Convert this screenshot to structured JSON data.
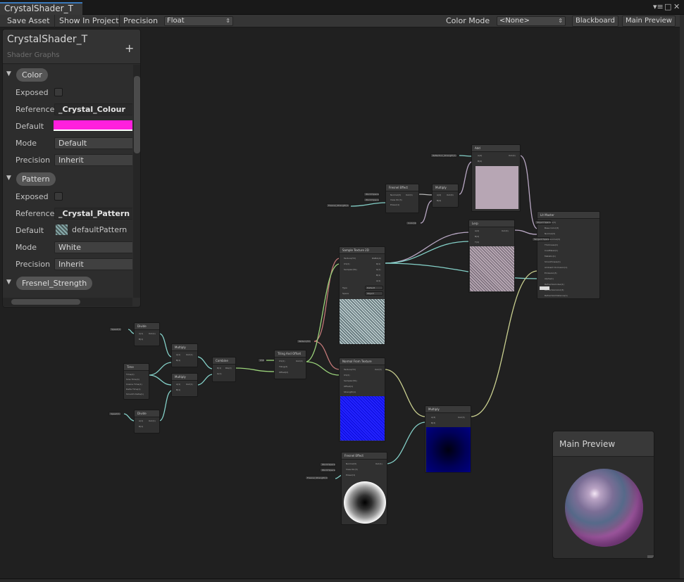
{
  "window": {
    "tab_title": "CrystalShader_T",
    "controls": {
      "menu": "▾≡",
      "maximize": "□",
      "close": "✕"
    }
  },
  "toolbar": {
    "save_asset": "Save Asset",
    "show_in_project": "Show In Project",
    "precision_label": "Precision",
    "precision_value": "Float",
    "color_mode_label": "Color Mode",
    "color_mode_value": "<None>",
    "blackboard": "Blackboard",
    "main_preview": "Main Preview"
  },
  "blackboard": {
    "title": "CrystalShader_T",
    "subtitle": "Shader Graphs",
    "add_icon": "+",
    "properties": [
      {
        "name": "Color",
        "exposed_label": "Exposed",
        "reference_label": "Reference",
        "reference": "_Crystal_Colour",
        "default_label": "Default",
        "default_color": "#ff1fdd",
        "mode_label": "Mode",
        "mode": "Default",
        "precision_label": "Precision",
        "precision": "Inherit"
      },
      {
        "name": "Pattern",
        "exposed_label": "Exposed",
        "reference_label": "Reference",
        "reference": "_Crystal_Pattern",
        "default_label": "Default",
        "default_texture": "defaultPattern",
        "mode_label": "Mode",
        "mode": "White",
        "precision_label": "Precision",
        "precision": "Inherit"
      },
      {
        "name": "Fresnel_Strength"
      }
    ]
  },
  "main_preview": {
    "title": "Main Preview"
  },
  "nodes": {
    "fresnel_top": {
      "title": "Fresnel Effect",
      "ports": [
        "Normal(3)",
        "View Dir(3)",
        "Power(1)"
      ],
      "out": "Out(1)",
      "in_pills": [
        "World Space",
        "World Space",
        "Fresnel_Strength(1)"
      ]
    },
    "multiply_top": {
      "title": "Multiply",
      "ports": [
        "A(4)",
        "B(4)"
      ],
      "out": "Out(4)"
    },
    "add": {
      "title": "Add",
      "ports": [
        "A(4)",
        "B(4)"
      ],
      "out": "Out(4)",
      "in_pill": "Reflection_Strength(1)"
    },
    "lerp": {
      "title": "Lerp",
      "ports": [
        "A(4)",
        "B(4)",
        "T(4)"
      ],
      "out": "Out(4)"
    },
    "color_prop": {
      "title": "Color(4)"
    },
    "litmaster": {
      "title": "Lit Master",
      "ports": [
        "Position(3)",
        "Base Color(3)",
        "Normal(3)",
        "BentNormal(3)",
        "Thickness(1)",
        "CoatMask(1)",
        "Metallic(1)",
        "Smoothness(1)",
        "Ambient Occlusion(1)",
        "Emission(3)",
        "Alpha(1)",
        "RefractionIndex(1)",
        "RefractionColor(3)",
        "RefractionDistance(1)"
      ],
      "in_pills": [
        "Object Space",
        "Tangent Space"
      ]
    },
    "sample_tex": {
      "title": "Sample Texture 2D",
      "ports": [
        "Texture(T2)",
        "UV(2)",
        "Sampler(SS)"
      ],
      "outs": [
        "RGBA(4)",
        "R(1)",
        "G(1)",
        "B(1)",
        "A(1)"
      ],
      "type_label": "Type",
      "type_value": "Default",
      "space_label": "Space",
      "space_value": "Object"
    },
    "pattern_prop": {
      "title": "Pattern(T2)"
    },
    "normal_tex": {
      "title": "Normal From Texture",
      "ports": [
        "Texture(T2)",
        "UV(2)",
        "Sampler(SS)",
        "Offset(1)",
        "Strength(1)"
      ],
      "out": "Out(3)"
    },
    "tiling": {
      "title": "Tiling And Offset",
      "ports": [
        "UV(2)",
        "Tiling(2)",
        "Offset(2)"
      ],
      "out": "Out(2)",
      "in_pill": "UV0"
    },
    "combine": {
      "title": "Combine",
      "ports": [
        "R(1)",
        "G(1)"
      ],
      "out": "RG(2)"
    },
    "divide": {
      "title": "Divide",
      "ports": [
        "A(1)",
        "B(1)"
      ],
      "out": "Out(1)",
      "in_pill": "Speed(1)"
    },
    "time": {
      "title": "Time",
      "outs": [
        "Time(1)",
        "Sine Time(1)",
        "Cosine Time(1)",
        "Delta Time(1)",
        "Smooth Delta(1)"
      ]
    },
    "multiply_a": {
      "title": "Multiply",
      "ports": [
        "A(1)",
        "B(1)"
      ],
      "out": "Out(1)"
    },
    "multiply_b": {
      "title": "Multiply",
      "ports": [
        "A(1)",
        "B(1)"
      ],
      "out": "Out(1)"
    },
    "divide_b": {
      "title": "Divide",
      "ports": [
        "A(1)",
        "B(1)"
      ],
      "out": "Out(1)",
      "in_pill": "Speed(1)"
    },
    "multiply_bottom": {
      "title": "Multiply",
      "ports": [
        "A(3)",
        "B(3)"
      ],
      "out": "Out(3)"
    },
    "fresnel_bottom": {
      "title": "Fresnel Effect",
      "ports": [
        "Normal(3)",
        "View Dir(3)",
        "Power(1)"
      ],
      "out": "Out(1)",
      "in_pills": [
        "World Space",
        "World Space",
        "Fresnel_Strength(1)"
      ]
    }
  }
}
